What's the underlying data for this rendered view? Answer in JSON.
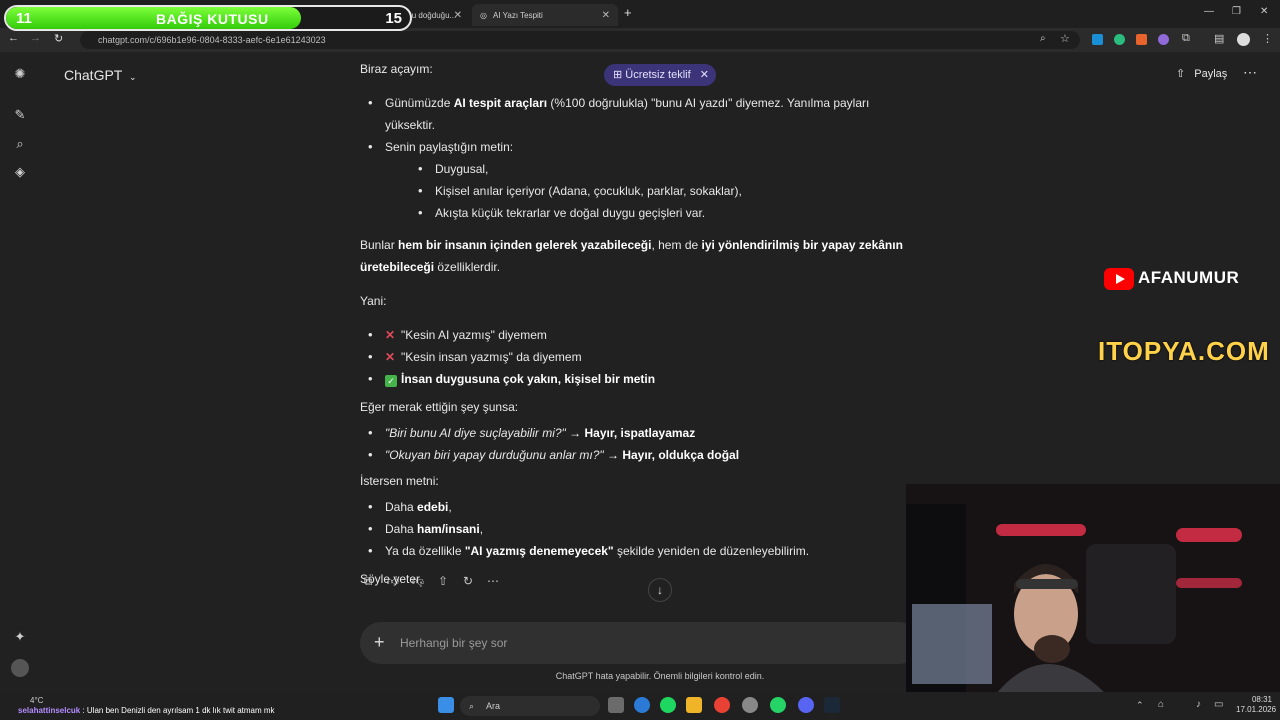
{
  "browser": {
    "tabs": [
      {
        "title": "(1) X'te Salim: \"Bunu doğduğu...",
        "icon": "x-logo-icon"
      },
      {
        "title": "AI Yazı Tespiti",
        "icon": "chatgpt-icon",
        "active": true
      }
    ],
    "url": "chatgpt.com/c/696b1e96-0804-8333-aefc-6e1e61243023"
  },
  "donation": {
    "left_count": "11",
    "label": "BAĞIŞ KUTUSU",
    "right_count": "15",
    "progress_fraction": 0.73,
    "color": "#4ddd1a"
  },
  "header": {
    "model": "ChatGPT",
    "promo": "Ücretsiz teklif",
    "share": "Paylaş"
  },
  "message": {
    "intro": "Biraz açayım:",
    "bullets1_a_pre": "Günümüzde ",
    "bullets1_a_bold": "AI tespit araçları",
    "bullets1_a_post": " (%100 doğrulukla) \"bunu AI yazdı\" diyemez. Yanılma payları yüksektir.",
    "bullets1_b": "Senin paylaştığın metin:",
    "sub": [
      "Duygusal,",
      "Kişisel anılar içeriyor (Adana, çocukluk, parklar, sokaklar),",
      "Akışta küçük tekrarlar ve doğal duygu geçişleri var."
    ],
    "para2_a": "Bunlar ",
    "para2_b": "hem bir insanın içinden gelerek yazabileceği",
    "para2_c": ", hem de ",
    "para2_d": "iyi yönlendirilmiş bir yapay zekânın üretebileceği",
    "para2_e": " özelliklerdir.",
    "yani": "Yani:",
    "yani1": "\"Kesin AI yazmış\" diyemem",
    "yani2": "\"Kesin insan yazmış\" da diyemem",
    "yani3": "İnsan duygusuna çok yakın, kişisel bir metin",
    "merak": "Eğer merak ettiğin şey şunsa:",
    "q1_italic": "\"Biri bunu AI diye suçlayabilir mi?\"",
    "q1_answer": " → Hayır, ispatlayamaz",
    "q2_italic": "\"Okuyan biri yapay durduğunu anlar mı?\"",
    "q2_answer": " → Hayır, oldukça doğal",
    "istersen": "İstersen metni:",
    "opt1_pre": "Daha ",
    "opt1_bold": "edebi",
    "opt1_post": ",",
    "opt2_pre": "Daha ",
    "opt2_bold": "ham/insani",
    "opt2_post": ",",
    "opt3_pre": "Ya da özellikle ",
    "opt3_bold": "\"AI yazmış denemeyecek\"",
    "opt3_post": " şekilde yeniden de düzenleyebilirim.",
    "closing": "Söyle yeter."
  },
  "composer": {
    "placeholder": "Herhangi bir şey sor",
    "disclaimer": "ChatGPT hata yapabilir. Önemli bilgileri kontrol edin."
  },
  "overlays": {
    "youtube_channel": "AFANUMUR",
    "sponsor": "ITOPYA.COM"
  },
  "taskbar": {
    "weather": "4°C",
    "chat_user": "selahattinselcuk",
    "chat_msg": " : Ulan ben Denizli den ayrılsam 1 dk lık twit atmam mk",
    "search": "Ara",
    "time": "08:31",
    "date": "17.01.2026"
  }
}
